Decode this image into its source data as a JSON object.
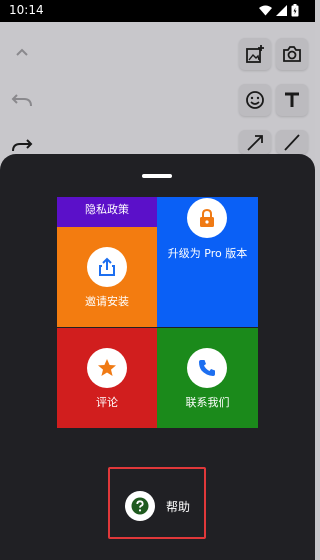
{
  "status_bar": {
    "time": "10:14",
    "icons": [
      "wifi-icon",
      "signal-icon",
      "battery-icon"
    ]
  },
  "background": {
    "left_tools": [
      "chevron-up-icon",
      "undo-icon",
      "redo-icon"
    ],
    "right_tools": [
      "add-image-icon",
      "camera-icon",
      "emoji-icon",
      "text-icon",
      "arrow-icon",
      "line-icon"
    ]
  },
  "sheet": {
    "tiles": {
      "privacy": {
        "label": "隐私政策",
        "color": "#5b10c9"
      },
      "upgrade": {
        "label": "升级为 Pro 版本",
        "icon": "lock-icon",
        "color": "#0a60f6",
        "icon_color": "#f07a14"
      },
      "invite": {
        "label": "邀请安装",
        "icon": "share-icon",
        "color": "#f37c10",
        "icon_color": "#1d6ff0"
      },
      "review": {
        "label": "评论",
        "icon": "star-icon",
        "color": "#d11e1e",
        "icon_color": "#f07a14"
      },
      "contact": {
        "label": "联系我们",
        "icon": "phone-icon",
        "color": "#1b8a1b",
        "icon_color": "#1d6ff0"
      }
    },
    "help": {
      "label": "帮助",
      "icon": "question-icon"
    }
  }
}
